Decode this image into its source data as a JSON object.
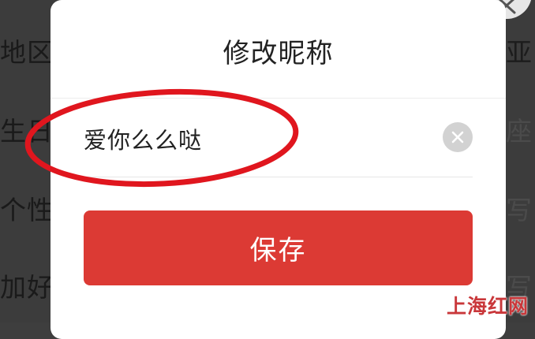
{
  "background_page": {
    "rows": [
      {
        "label": "地区",
        "value": "亚"
      },
      {
        "label": "生日",
        "value": "座"
      },
      {
        "label": "个性",
        "value": "写"
      },
      {
        "label": "加好",
        "value": "写"
      }
    ]
  },
  "dialog": {
    "title": "修改昵称",
    "nickname_value": "爱你么么哒",
    "save_label": "保存"
  },
  "watermark": "上海红网",
  "colors": {
    "accent": "#dc3a34",
    "annotation": "#e0161e",
    "overlay": "#3c3c3c"
  },
  "icons": {
    "clear": "clear-icon",
    "close": "close-icon"
  }
}
